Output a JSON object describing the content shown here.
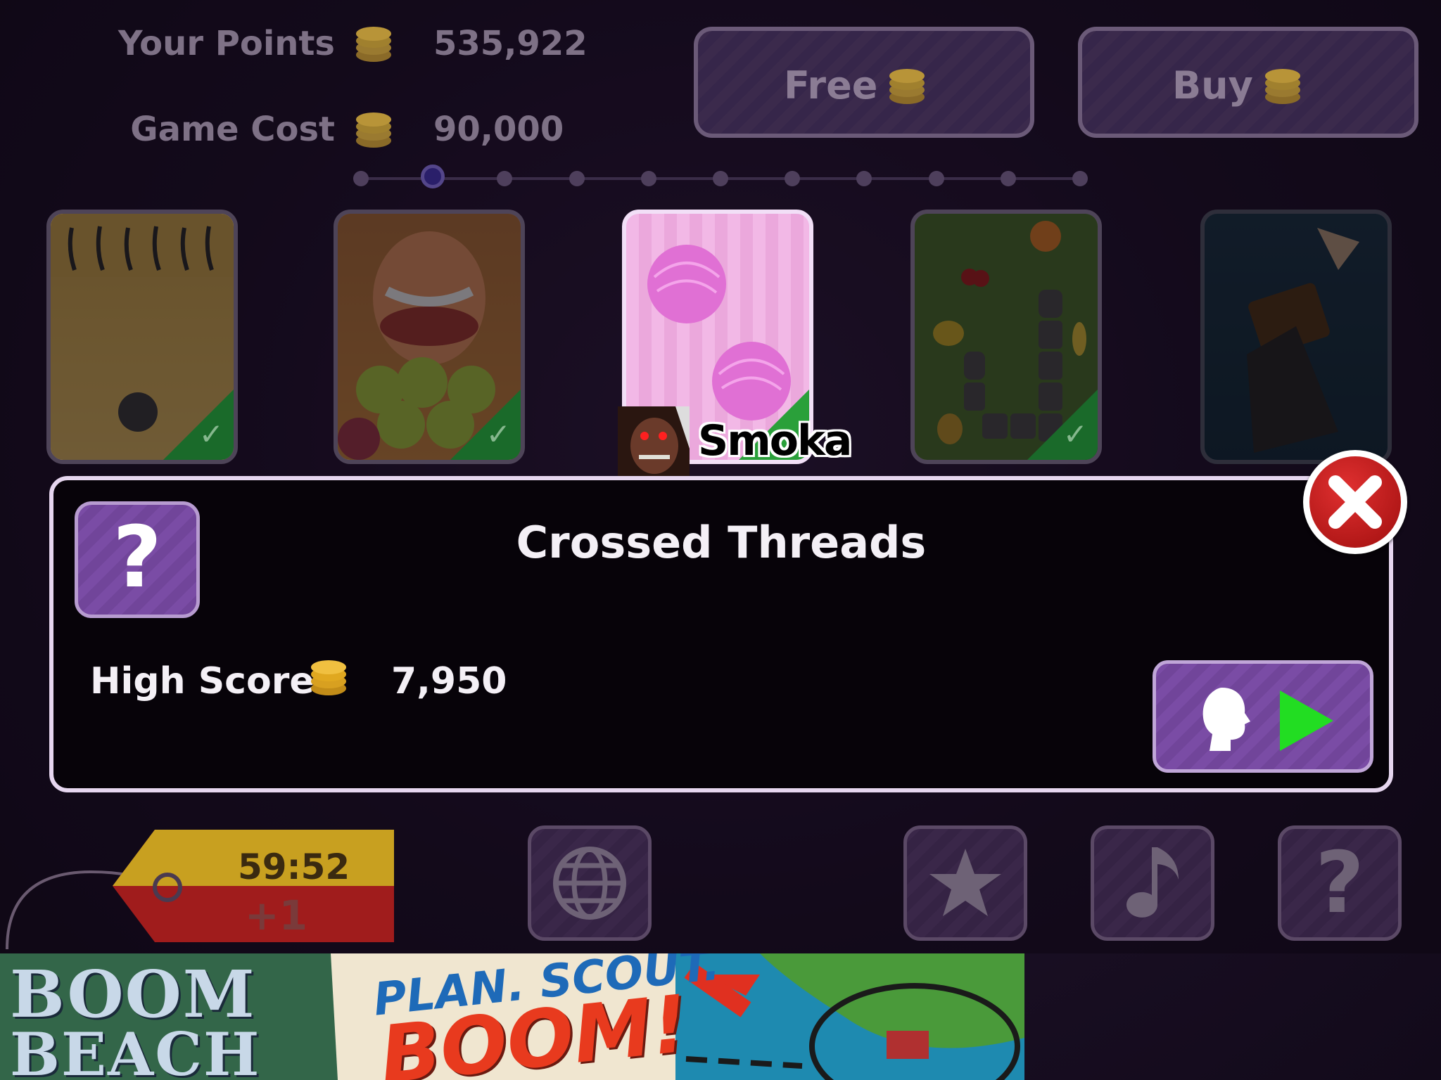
{
  "stats": {
    "points_label": "Your Points",
    "points_value": "535,922",
    "cost_label": "Game Cost",
    "cost_value": "90,000"
  },
  "top_buttons": {
    "free_label": "Free",
    "buy_label": "Buy"
  },
  "pager": {
    "total": 11,
    "active_index": 1
  },
  "cards": [
    {
      "name": "pinball",
      "completed": true
    },
    {
      "name": "apple-farmer",
      "completed": true
    },
    {
      "name": "yarn-balls",
      "completed": true,
      "selected": true
    },
    {
      "name": "snake",
      "completed": true
    },
    {
      "name": "dark-fantasy",
      "completed": false
    }
  ],
  "overlay": {
    "username": "Smoka"
  },
  "detail": {
    "title": "Crossed Threads",
    "help_glyph": "?",
    "high_score_label": "High Score",
    "high_score_value": "7,950",
    "play_icon": "single-player-play-icon"
  },
  "timer": {
    "time": "59:52",
    "bonus": "+1"
  },
  "bottom_icons": [
    "globe-icon",
    "star-icon",
    "music-note-icon",
    "help-icon"
  ],
  "ad": {
    "brand_line1": "BOOM",
    "brand_line2": "BEACH",
    "slogan_line1": "PLAN. SCOUT.",
    "slogan_line2": "BOOM!"
  },
  "colors": {
    "accent_purple": "#7a4ca5",
    "close_red": "#c01818",
    "play_green": "#22dd22",
    "coin_gold": "#e0a820"
  }
}
